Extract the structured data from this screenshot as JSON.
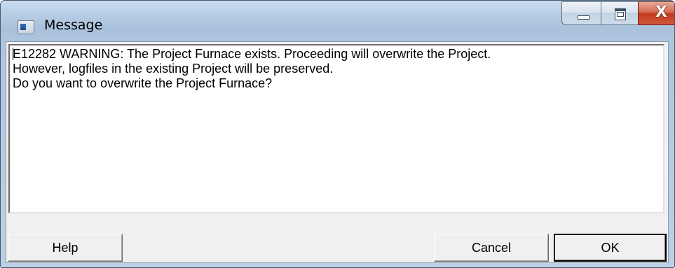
{
  "window": {
    "title": "Message",
    "controls": {
      "minimize_icon": "minimize-icon",
      "maximize_icon": "maximize-icon",
      "close_icon": "close-icon",
      "close_glyph": "X"
    },
    "app_icon": "application-icon"
  },
  "message": {
    "lines": [
      "E12282 WARNING: The Project Furnace exists. Proceeding will overwrite the Project.",
      "However, logfiles in the existing Project will be preserved.",
      "Do you want to overwrite the Project Furnace?"
    ]
  },
  "buttons": {
    "help": "Help",
    "cancel": "Cancel",
    "ok": "OK"
  },
  "colors": {
    "close_button": "#c9452a",
    "titlebar": "#b4cbe2",
    "dialog_face": "#f0f0f0"
  }
}
